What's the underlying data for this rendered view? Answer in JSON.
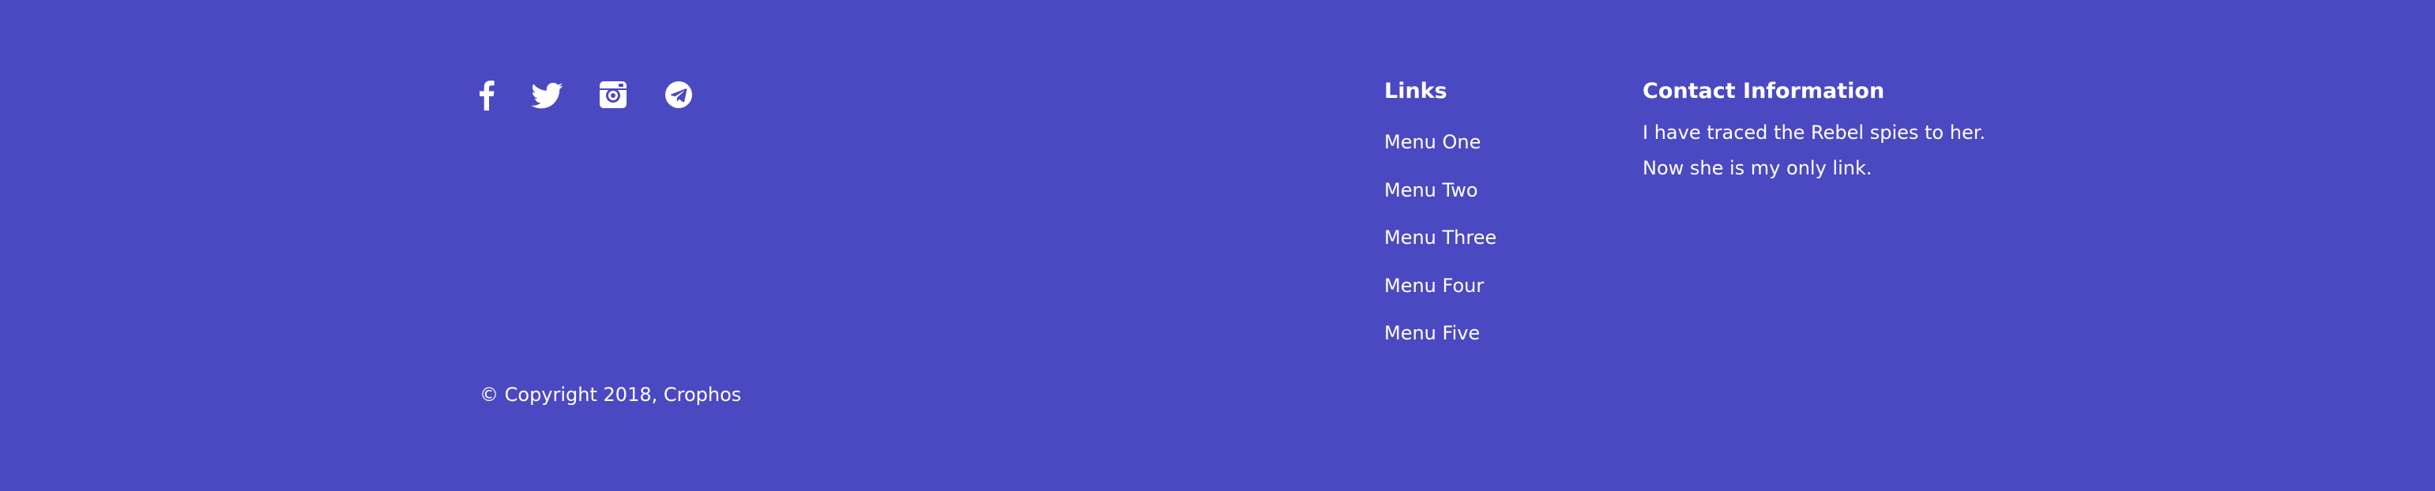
{
  "theme": {
    "background": "#4b49c1",
    "text": "#ffffff"
  },
  "social": [
    {
      "icon": "facebook-icon"
    },
    {
      "icon": "twitter-icon"
    },
    {
      "icon": "instagram-icon"
    },
    {
      "icon": "telegram-icon"
    }
  ],
  "links": {
    "heading": "Links",
    "items": [
      {
        "label": "Menu One"
      },
      {
        "label": "Menu Two"
      },
      {
        "label": "Menu Three"
      },
      {
        "label": "Menu Four"
      },
      {
        "label": "Menu Five"
      }
    ]
  },
  "contact": {
    "heading": "Contact Information",
    "lines": [
      "I have traced the Rebel spies to her.",
      "Now she is my only link."
    ]
  },
  "copyright": "© Copyright 2018, Crophos"
}
